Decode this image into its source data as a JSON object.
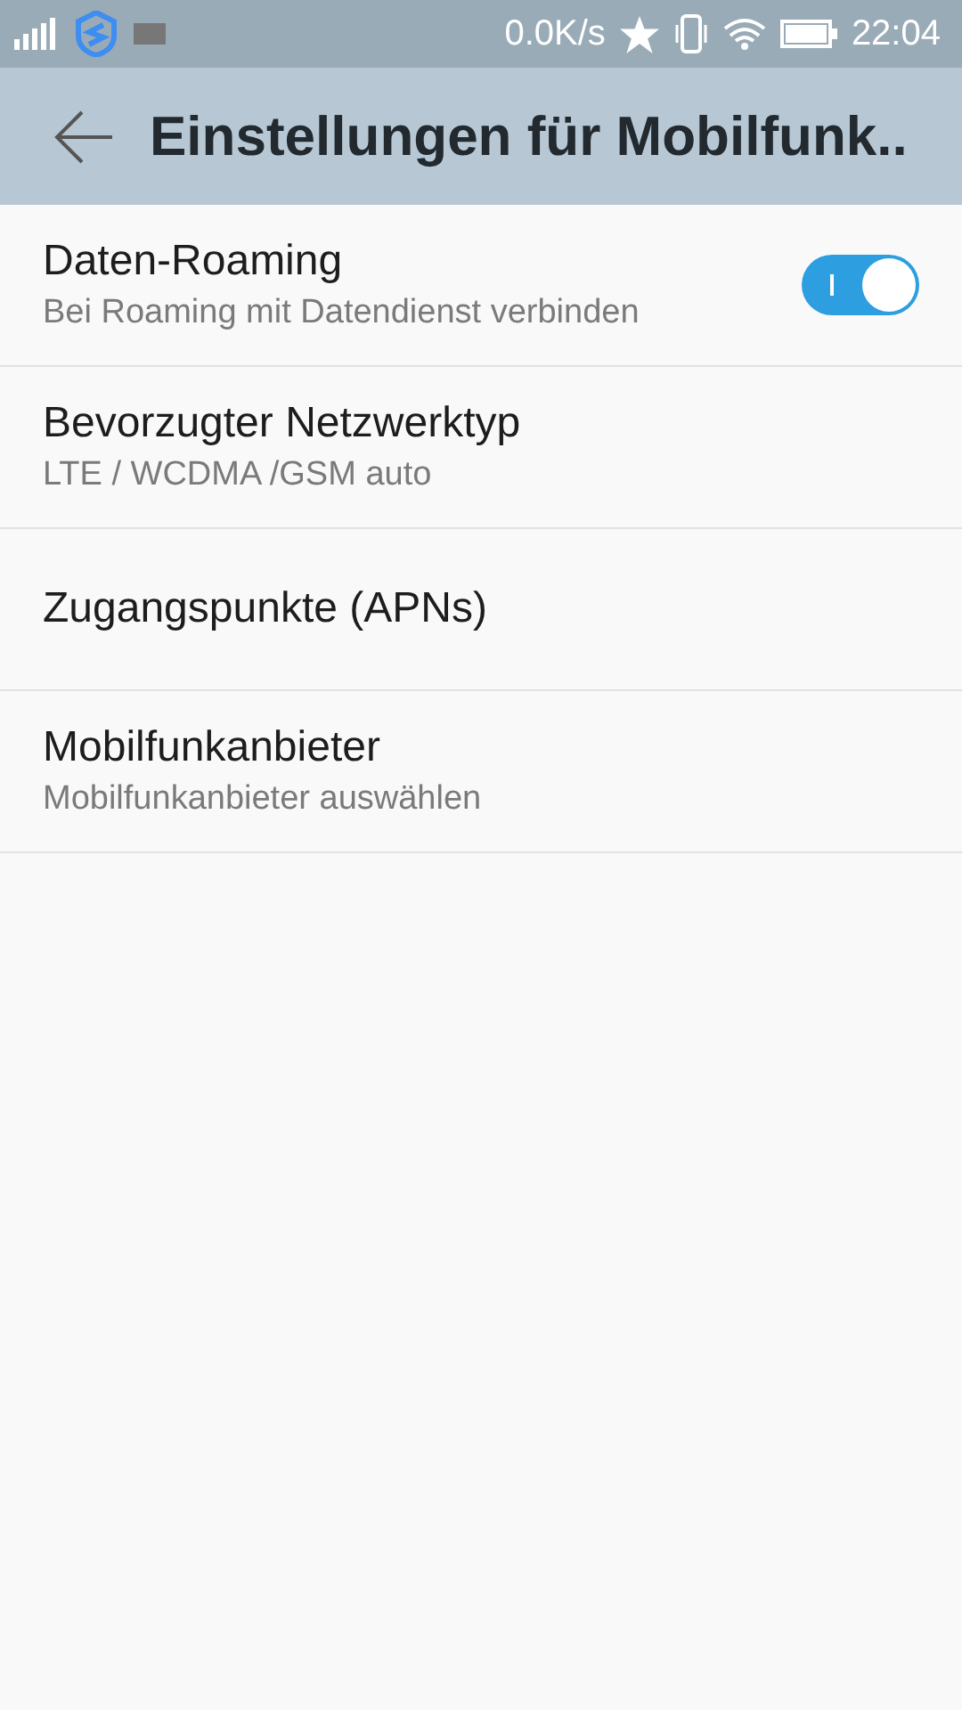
{
  "status_bar": {
    "speed": "0.0K/s",
    "time": "22:04"
  },
  "app_bar": {
    "title": "Einstellungen für Mobilfunk.."
  },
  "settings": [
    {
      "title": "Daten-Roaming",
      "summary": "Bei Roaming mit Datendienst verbinden",
      "kind": "switch",
      "on": true
    },
    {
      "title": "Bevorzugter Netzwerktyp",
      "summary": "LTE / WCDMA /GSM auto",
      "kind": "plain"
    },
    {
      "title": "Zugangspunkte (APNs)",
      "kind": "plain"
    },
    {
      "title": "Mobilfunkanbieter",
      "summary": "Mobilfunkanbieter auswählen",
      "kind": "plain"
    }
  ]
}
